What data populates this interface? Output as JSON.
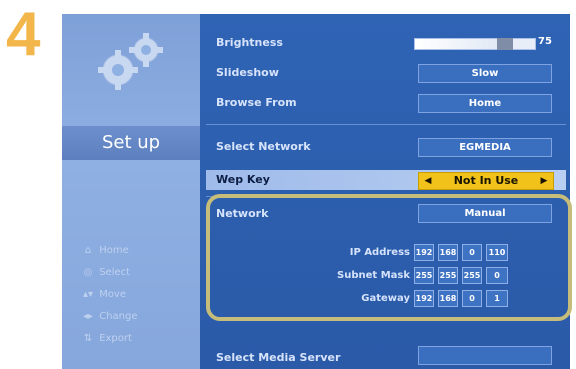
{
  "step": "4",
  "sidebar": {
    "title": "Set up",
    "hints": [
      {
        "icon": "home-icon",
        "glyph": "⌂",
        "label": "Home"
      },
      {
        "icon": "select-icon",
        "glyph": "◎",
        "label": "Select"
      },
      {
        "icon": "move-icon",
        "glyph": "▴▾",
        "label": "Move"
      },
      {
        "icon": "change-icon",
        "glyph": "◂▸",
        "label": "Change"
      },
      {
        "icon": "export-icon",
        "glyph": "⇅",
        "label": "Export"
      }
    ]
  },
  "settings": {
    "brightness": {
      "label": "Brightness",
      "value": "75",
      "level": 0.75
    },
    "slideshow": {
      "label": "Slideshow",
      "value": "Slow"
    },
    "browse_from": {
      "label": "Browse From",
      "value": "Home"
    },
    "select_network": {
      "label": "Select Network",
      "value": "EGMEDIA"
    },
    "wep_key": {
      "label": "Wep Key",
      "value": "Not In Use"
    },
    "network": {
      "label": "Network",
      "value": "Manual"
    },
    "ip_address": {
      "label": "IP Address",
      "octets": [
        "192",
        "168",
        "0",
        "110"
      ]
    },
    "subnet_mask": {
      "label": "Subnet Mask",
      "octets": [
        "255",
        "255",
        "255",
        "0"
      ]
    },
    "gateway": {
      "label": "Gateway",
      "octets": [
        "192",
        "168",
        "0",
        "1"
      ]
    },
    "media_server": {
      "label": "Select Media Server",
      "value": ""
    }
  },
  "colors": {
    "step_number": "#f2b64a",
    "selector": "#f0c21a",
    "highlight": "#c6bd7a"
  }
}
